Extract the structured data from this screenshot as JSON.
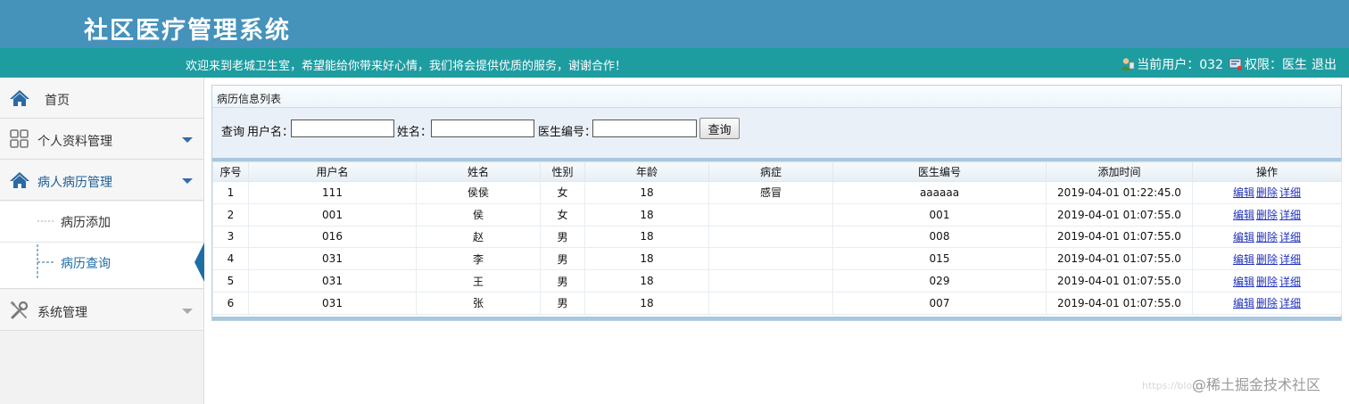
{
  "header": {
    "title": "社区医疗管理系统"
  },
  "infobar": {
    "welcome": "欢迎来到老城卫生室，希望能给你带来好心情，我们将会提供优质的服务，谢谢合作！",
    "current_user": "当前用户：032",
    "role": "权限：医生",
    "logout": "退出"
  },
  "sidebar": {
    "items": [
      {
        "label": "首页",
        "icon": "home-icon"
      },
      {
        "label": "个人资料管理",
        "icon": "grid-icon"
      },
      {
        "label": "病人病历管理",
        "icon": "home-icon"
      },
      {
        "label": "系统管理",
        "icon": "wrench-icon"
      }
    ],
    "sub_items": [
      {
        "label": "病历添加"
      },
      {
        "label": "病历查询"
      }
    ]
  },
  "panel": {
    "title": "病历信息列表",
    "search": {
      "prefix": "查询",
      "username_label": "用户名：",
      "name_label": "姓名：",
      "doctor_label": "医生编号：",
      "button": "查询"
    }
  },
  "table": {
    "headers": [
      "序号",
      "用户名",
      "姓名",
      "性别",
      "年龄",
      "病症",
      "医生编号",
      "添加时间",
      "操作"
    ],
    "rows": [
      {
        "no": "1",
        "username": "111",
        "name": "侯侯",
        "gender": "女",
        "age": "18",
        "disease": "感冒",
        "doctor": "aaaaaa",
        "time": "2019-04-01 01:22:45.0"
      },
      {
        "no": "2",
        "username": "001",
        "name": "侯",
        "gender": "女",
        "age": "18",
        "disease": "",
        "doctor": "001",
        "time": "2019-04-01 01:07:55.0"
      },
      {
        "no": "3",
        "username": "016",
        "name": "赵",
        "gender": "男",
        "age": "18",
        "disease": "",
        "doctor": "008",
        "time": "2019-04-01 01:07:55.0"
      },
      {
        "no": "4",
        "username": "031",
        "name": "李",
        "gender": "男",
        "age": "18",
        "disease": "",
        "doctor": "015",
        "time": "2019-04-01 01:07:55.0"
      },
      {
        "no": "5",
        "username": "031",
        "name": "王",
        "gender": "男",
        "age": "18",
        "disease": "",
        "doctor": "029",
        "time": "2019-04-01 01:07:55.0"
      },
      {
        "no": "6",
        "username": "031",
        "name": "张",
        "gender": "男",
        "age": "18",
        "disease": "",
        "doctor": "007",
        "time": "2019-04-01 01:07:55.0"
      }
    ],
    "actions": {
      "edit": "编辑",
      "delete": "删除",
      "detail": "详细"
    }
  },
  "watermark": "@稀土掘金技术社区",
  "watermark_faint": "https://blog"
}
